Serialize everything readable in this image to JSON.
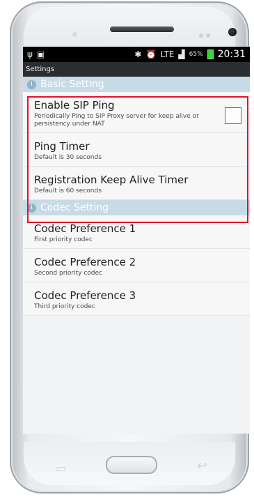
{
  "status_bar": {
    "left_icons": [
      "usb-icon",
      "image-icon"
    ],
    "right_icons": [
      "bluetooth-icon",
      "alarm-icon",
      "lte-icon",
      "signal-icon",
      "battery-icon"
    ],
    "battery_pct": "65%",
    "lte": "LTE",
    "time": "20:31"
  },
  "screen": {
    "title": "Settings"
  },
  "sections": [
    {
      "header": "Basic Setting",
      "items": [
        {
          "title": "Enable SIP Ping",
          "subtitle": "Periodically Ping to SIP Proxy server for keep alive or persistency under NAT",
          "checkbox": false
        },
        {
          "title": "Ping Timer",
          "subtitle": "Default is 30 seconds"
        },
        {
          "title": "Registration Keep Alive Timer",
          "subtitle": "Default is 60 seconds"
        }
      ]
    },
    {
      "header": "Codec Setting",
      "items": [
        {
          "title": "Codec Preference 1",
          "subtitle": "First priority codec"
        },
        {
          "title": "Codec Preference 2",
          "subtitle": "Second priority codec"
        },
        {
          "title": "Codec Preference 3",
          "subtitle": "Third priority codec"
        }
      ]
    }
  ],
  "colors": {
    "highlight": "#e1122a",
    "section_header_bg": "#c7dbe6"
  }
}
